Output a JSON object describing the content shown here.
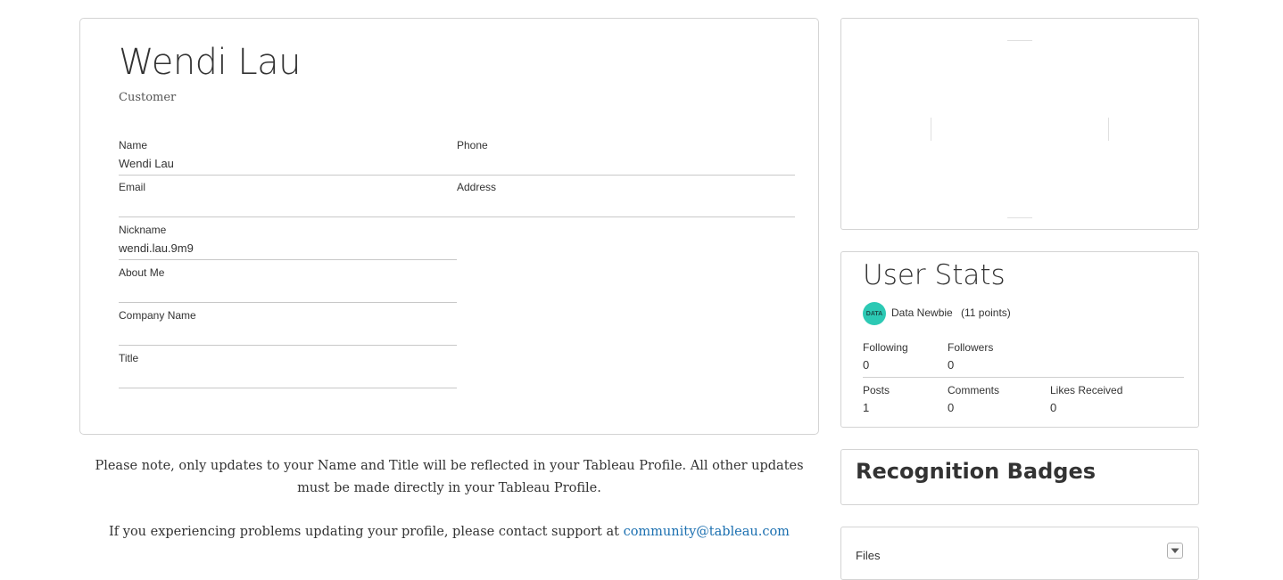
{
  "profile": {
    "display_name": "Wendi Lau",
    "role": "Customer",
    "fields": {
      "name": {
        "label": "Name",
        "value": "Wendi Lau"
      },
      "phone": {
        "label": "Phone",
        "value": ""
      },
      "email": {
        "label": "Email",
        "value": ""
      },
      "address": {
        "label": "Address",
        "value": ""
      },
      "nickname": {
        "label": "Nickname",
        "value": "wendi.lau.9m9"
      },
      "about_me": {
        "label": "About Me",
        "value": ""
      },
      "company_name": {
        "label": "Company Name",
        "value": ""
      },
      "title": {
        "label": "Title",
        "value": ""
      }
    }
  },
  "user_stats": {
    "title": "User Stats",
    "rank": {
      "icon": "data-newbie-badge-icon",
      "icon_text": "DATA",
      "name": "Data Newbie",
      "points": "(11 points)"
    },
    "following": {
      "label": "Following",
      "value": "0"
    },
    "followers": {
      "label": "Followers",
      "value": "0"
    },
    "posts": {
      "label": "Posts",
      "value": "1"
    },
    "comments": {
      "label": "Comments",
      "value": "0"
    },
    "likes_received": {
      "label": "Likes Received",
      "value": "0"
    }
  },
  "badges": {
    "title": "Recognition Badges"
  },
  "files": {
    "label": "Files",
    "toggle_icon": "caret-down-icon"
  },
  "notes": {
    "profile_update": "Please note, only updates to your Name and Title will be reflected in your Tableau Profile. All other updates must be made directly in your Tableau Profile.",
    "support_prefix": "If you experiencing problems updating your profile, please contact support at ",
    "support_email": "community@tableau.com"
  },
  "colors": {
    "link": "#1a6fb0",
    "border": "#d4d4d4",
    "rank_badge": "#2cc9b4"
  }
}
